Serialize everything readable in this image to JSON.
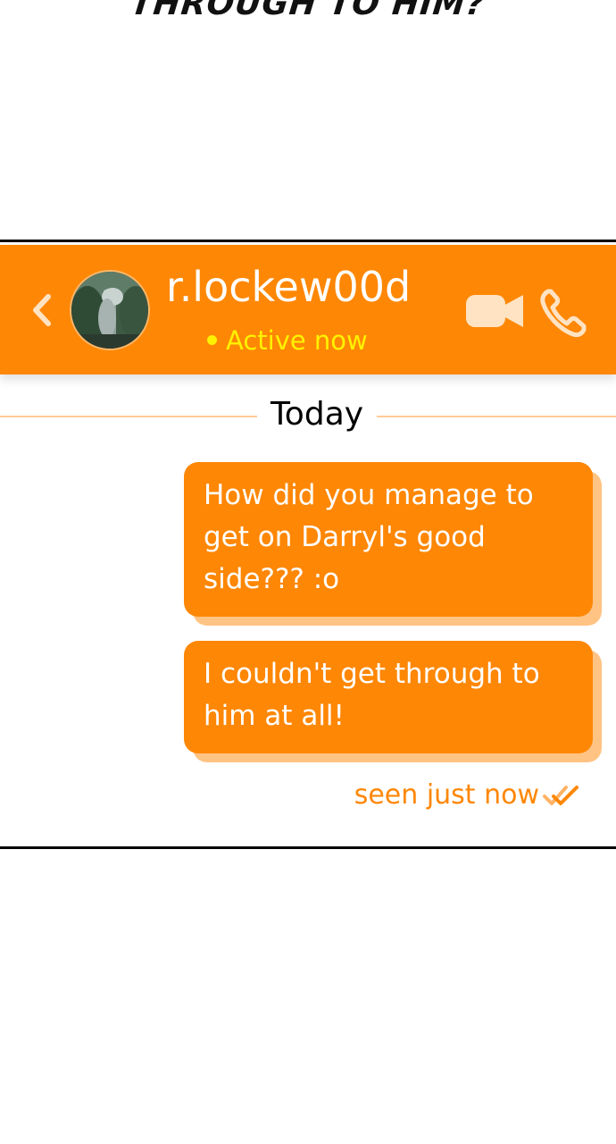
{
  "caption": {
    "text": "THROUGH TO HIM?"
  },
  "header": {
    "username": "r.lockew00d",
    "status": "Active now",
    "icons": {
      "back": "chevron-left-icon",
      "avatar": "avatar",
      "video": "video-camera-icon",
      "phone": "phone-icon"
    }
  },
  "chat": {
    "date_label": "Today",
    "messages": [
      {
        "text": "How did you manage to get on Darryl's good side??? :o",
        "sender": "me"
      },
      {
        "text": "I couldn't get through to him at all!",
        "sender": "me"
      }
    ],
    "seen_text": "seen just now"
  },
  "colors": {
    "accent": "#FE8705",
    "bubble_shadow": "#FFC383",
    "status": "#FFF200",
    "divider": "#FFCC99"
  }
}
